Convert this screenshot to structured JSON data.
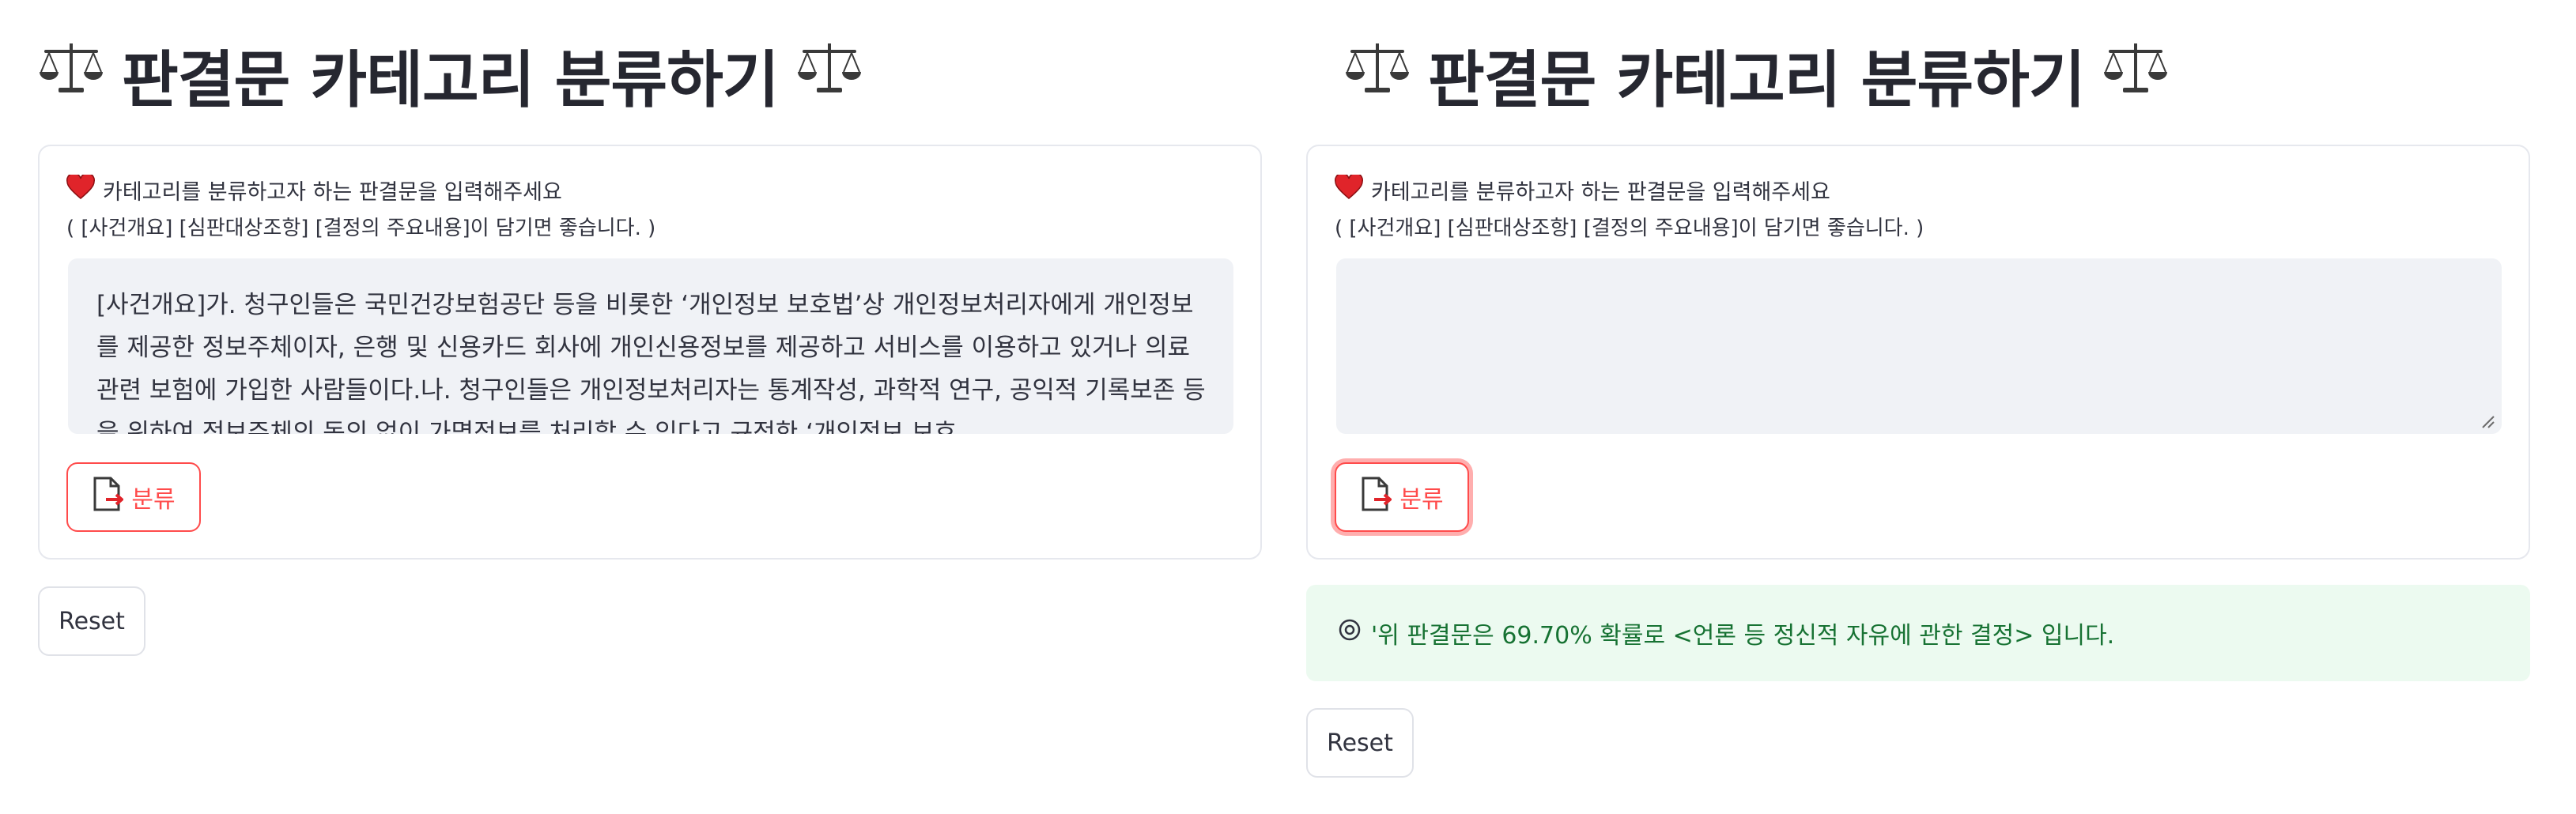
{
  "app": {
    "title": "판결문 카테고리 분류하기",
    "label_line1": "카테고리를 분류하고자 하는 판결문을 입력해주세요",
    "label_line2": "( [사건개요] [심판대상조항] [결정의 주요내용]이 담기면 좋습니다. )",
    "classify_button": "분류",
    "reset_button": "Reset",
    "icons": {
      "title": "balance-scale-icon",
      "label": "heart-icon",
      "button": "document-arrow-icon",
      "result": "target-icon"
    },
    "colors": {
      "accent": "#ff4b4b",
      "success_bg": "#ecfaf0",
      "success_text": "#177233",
      "textarea_bg": "#f0f2f6"
    }
  },
  "left_panel": {
    "textarea_value": "[사건개요]가. 청구인들은 국민건강보험공단 등을 비롯한 ‘개인정보 보호법’상 개인정보처리자에게 개인정보를 제공한 정보주체이자, 은행 및 신용카드 회사에 개인신용정보를 제공하고 서비스를 이용하고 있거나 의료 관련 보험에 가입한 사람들이다.나. 청구인들은 개인정보처리자는 통계작성, 과학적 연구, 공익적 기록보존 등을 위하여 정보주체의 동의 없이 가명정보를 처리할 수 있다고 규정한 ‘개인정보 보호"
  },
  "right_panel": {
    "textarea_value": "",
    "result_text": "'위 판결문은 69.70% 확률로 <언론 등 정신적 자유에 관한 결정> 입니다."
  }
}
